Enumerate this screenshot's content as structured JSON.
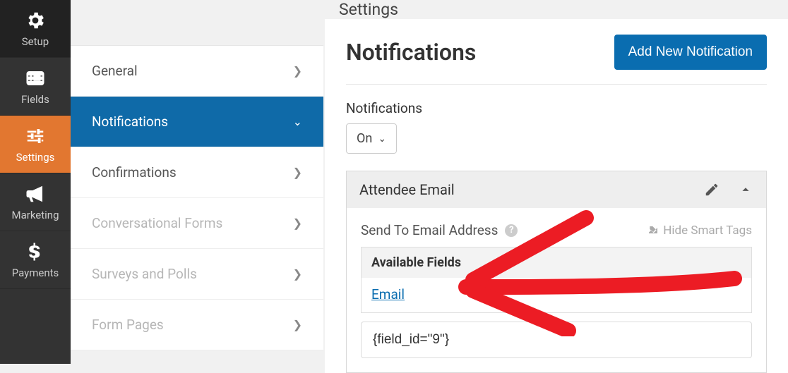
{
  "nav": {
    "setup": "Setup",
    "fields": "Fields",
    "settings": "Settings",
    "marketing": "Marketing",
    "payments": "Payments"
  },
  "sidebar": {
    "general": "General",
    "notifications": "Notifications",
    "confirmations": "Confirmations",
    "conversational": "Conversational Forms",
    "surveys": "Surveys and Polls",
    "formpages": "Form Pages"
  },
  "header": {
    "title": "Settings"
  },
  "main": {
    "title": "Notifications",
    "addBtn": "Add New Notification",
    "notifLabel": "Notifications",
    "statusValue": "On",
    "panelTitle": "Attendee Email",
    "sendToLabel": "Send To Email Address",
    "hideTags": "Hide Smart Tags",
    "availableFields": "Available Fields",
    "emailField": "Email",
    "inputValue": "{field_id=\"9\"}"
  }
}
